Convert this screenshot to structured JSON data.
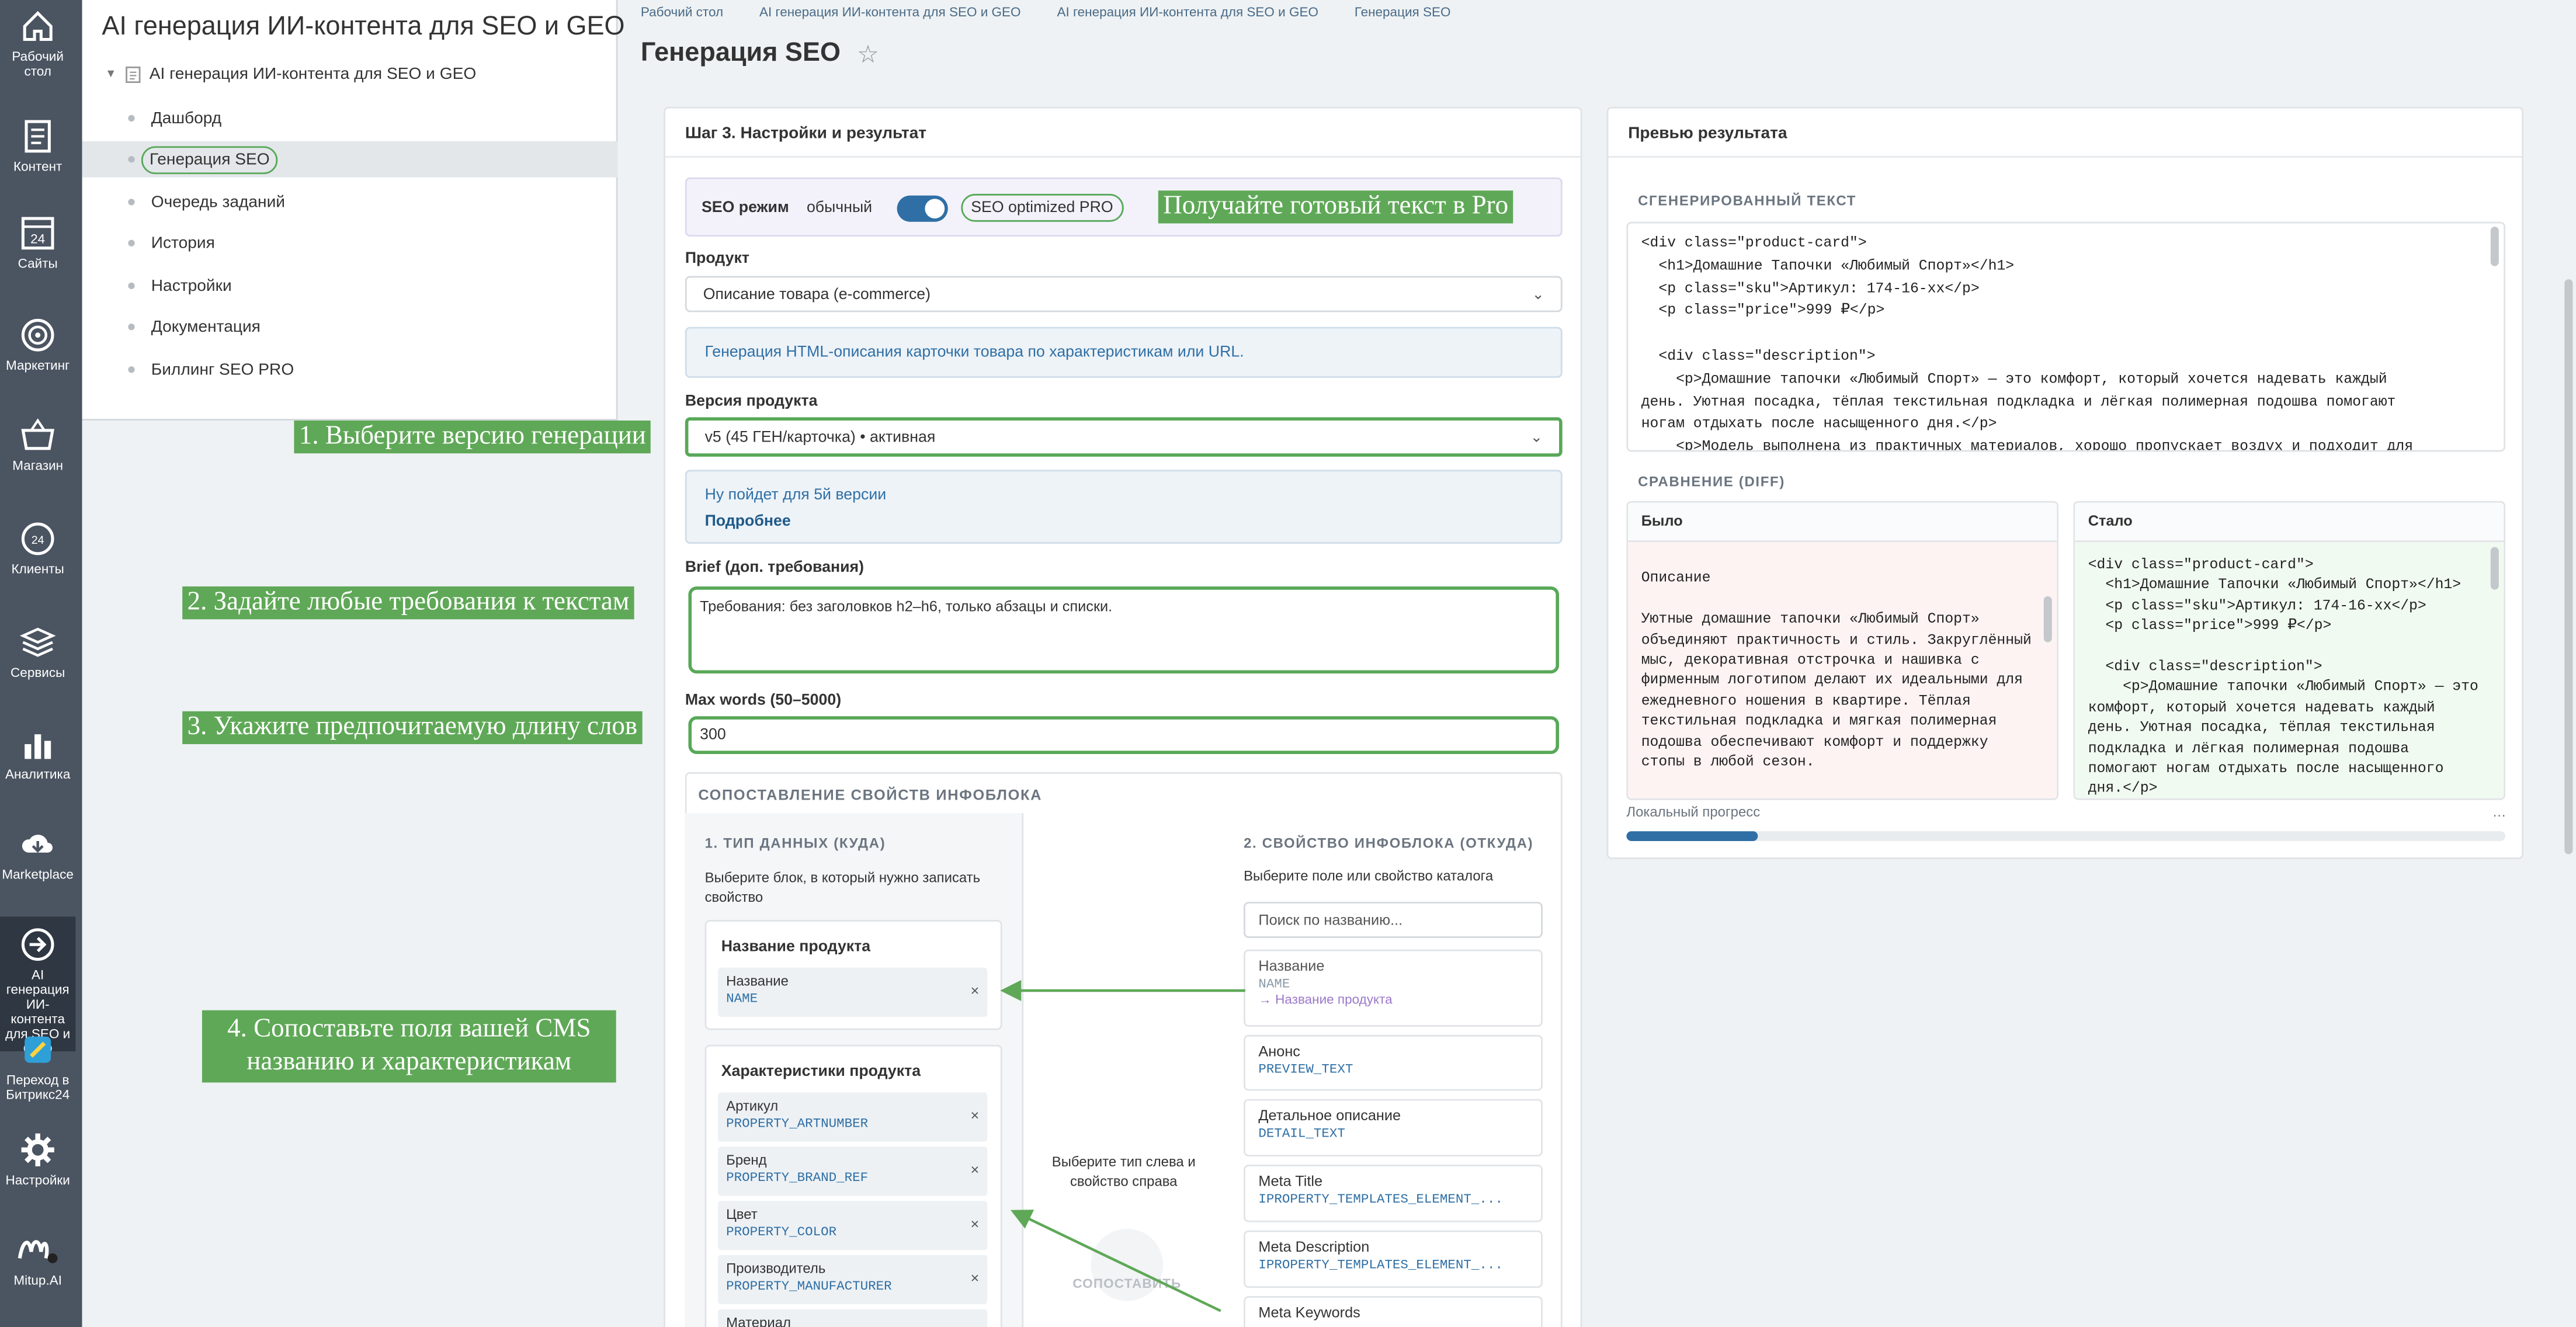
{
  "rail": [
    {
      "label": "Рабочий стол",
      "icon": "home-icon"
    },
    {
      "label": "Контент",
      "icon": "document-icon"
    },
    {
      "label": "Сайты",
      "icon": "calendar-24-icon"
    },
    {
      "label": "Маркетинг",
      "icon": "target-icon"
    },
    {
      "label": "Магазин",
      "icon": "basket-icon"
    },
    {
      "label": "Клиенты",
      "icon": "crm-24-icon"
    },
    {
      "label": "Сервисы",
      "icon": "layers-icon"
    },
    {
      "label": "Аналитика",
      "icon": "bar-chart-icon"
    },
    {
      "label": "Marketplace",
      "icon": "cloud-download-icon"
    },
    {
      "label": "AI генерация ИИ-контента для SEO и GEO",
      "icon": "arrow-circle-icon"
    },
    {
      "label": "Переход в Битрикс24",
      "icon": "bitrix-icon"
    },
    {
      "label": "Настройки",
      "icon": "gear-icon"
    },
    {
      "label": "Mitup.AI",
      "icon": "mitup-logo-icon"
    }
  ],
  "tree": {
    "app_title": "AI генерация ИИ-контента для SEO и GEO",
    "root": "AI генерация ИИ-контента для SEO и GEO",
    "items": [
      "Дашборд",
      "Генерация SEO",
      "Очередь заданий",
      "История",
      "Настройки",
      "Документация",
      "Биллинг SEO PRO"
    ]
  },
  "annotations": [
    "1. Выберите версию генерации",
    "2. Задайте любые требования к текстам",
    "3. Укажите предпочитаемую длину слов",
    "4. Сопоставьте поля вашей CMS названию и характеристикам",
    "Получайте готовый текст в Pro"
  ],
  "breadcrumbs": [
    "Рабочий стол",
    "AI генерация ИИ-контента для SEO и GEO",
    "AI генерация ИИ-контента для SEO и GEO",
    "Генерация SEO"
  ],
  "page_title": "Генерация SEO",
  "step": {
    "title": "Шаг 3. Настройки и результат",
    "seo_mode_label": "SEO режим",
    "mode_normal": "обычный",
    "mode_pro": "SEO optimized PRO",
    "mode_pro_enabled": true,
    "product_label": "Продукт",
    "product_value": "Описание товара (e-commerce)",
    "product_info": "Генерация HTML-описания карточки товара по характеристикам или URL.",
    "version_label": "Версия продукта",
    "version_value": "v5 (45 ГЕН/карточка) • активная",
    "version_info": "Ну пойдет для 5й версии",
    "version_more": "Подробнее",
    "brief_label": "Brief (доп. требования)",
    "brief_value": "Требования: без заголовков h2–h6, только абзацы и списки.",
    "maxwords_label": "Max words (50–5000)",
    "maxwords_value": "300"
  },
  "mapping": {
    "title": "СОПОСТАВЛЕНИЕ СВОЙСТВ ИНФОБЛОКА",
    "col1_title": "1. ТИП ДАННЫХ (КУДА)",
    "col1_hint": "Выберите блок, в который нужно записать свойство",
    "group1_title": "Название продукта",
    "group1_items": [
      {
        "name": "Название",
        "code": "NAME"
      }
    ],
    "group2_title": "Характеристики продукта",
    "group2_items": [
      {
        "name": "Артикул",
        "code": "PROPERTY_ARTNUMBER"
      },
      {
        "name": "Бренд",
        "code": "PROPERTY_BRAND_REF"
      },
      {
        "name": "Цвет",
        "code": "PROPERTY_COLOR"
      },
      {
        "name": "Производитель",
        "code": "PROPERTY_MANUFACTURER"
      },
      {
        "name": "Материал",
        "code": ""
      }
    ],
    "middle_hint": "Выберите тип слева и свойство справа",
    "middle_btn": "СОПОСТАВИТЬ",
    "col2_title": "2. СВОЙСТВО ИНФОБЛОКА (ОТКУДА)",
    "col2_hint": "Выберите поле или свойство каталога",
    "search_placeholder": "Поиск по названию...",
    "fields": [
      {
        "name": "Название",
        "code": "NAME",
        "mapped": "→ Название продукта"
      },
      {
        "name": "Анонс",
        "code": "PREVIEW_TEXT"
      },
      {
        "name": "Детальное описание",
        "code": "DETAIL_TEXT"
      },
      {
        "name": "Meta Title",
        "code": "IPROPERTY_TEMPLATES_ELEMENT_..."
      },
      {
        "name": "Meta Description",
        "code": "IPROPERTY_TEMPLATES_ELEMENT_..."
      },
      {
        "name": "Meta Keywords",
        "code": ""
      }
    ]
  },
  "preview": {
    "title": "Превью результата",
    "gen_label": "СГЕНЕРИРОВАННЫЙ ТЕКСТ",
    "gen_code": "<div class=\"product-card\">\n  <h1>Домашние Тапочки «Любимый Спорт»</h1>\n  <p class=\"sku\">Артикул: 174-16-xx</p>\n  <p class=\"price\">999 ₽</p>\n\n  <div class=\"description\">\n    <p>Домашние тапочки «Любимый Спорт» — это комфорт, который хочется надевать каждый\nдень. Уютная посадка, тёплая текстильная подкладка и лёгкая полимерная подошва помогают\nногам отдыхать после насыщенного дня.</p>\n    <p>Модель выполнена из практичных материалов, хорошо пропускает воздух и подходит для",
    "diff_label": "СРАВНЕНИЕ (DIFF)",
    "before_label": "Было",
    "after_label": "Стало",
    "before_text": "\nОписание\n\nУютные домашние тапочки «Любимый Спорт»\nобъединяют практичность и стиль. Закруглённый\nмыс, декоративная отстрочка и нашивка с\nфирменным логотипом делают их идеальными для\nежедневного ношения в квартире. Тёплая\nтекстильная подкладка и мягкая полимерная\nподошва обеспечивают комфорт и поддержку\nстопы в любой сезон.",
    "after_text": "<div class=\"product-card\">\n  <h1>Домашние Тапочки «Любимый Спорт»</h1>\n  <p class=\"sku\">Артикул: 174-16-xx</p>\n  <p class=\"price\">999 ₽</p>\n\n  <div class=\"description\">\n    <p>Домашние тапочки «Любимый Спорт» — это\nкомфорт, который хочется надевать каждый\nдень. Уютная посадка, тёплая текстильная\nподкладка и лёгкая полимерная подошва\nпомогают ногам отдыхать после насыщенного\nдня.</p>",
    "progress_label": "Локальный прогресс",
    "progress_value": "…",
    "progress_fraction": 0.15
  },
  "colors": {
    "accent": "#2f6fa5",
    "annotation": "#5fa857",
    "rail": "#4b5461"
  }
}
